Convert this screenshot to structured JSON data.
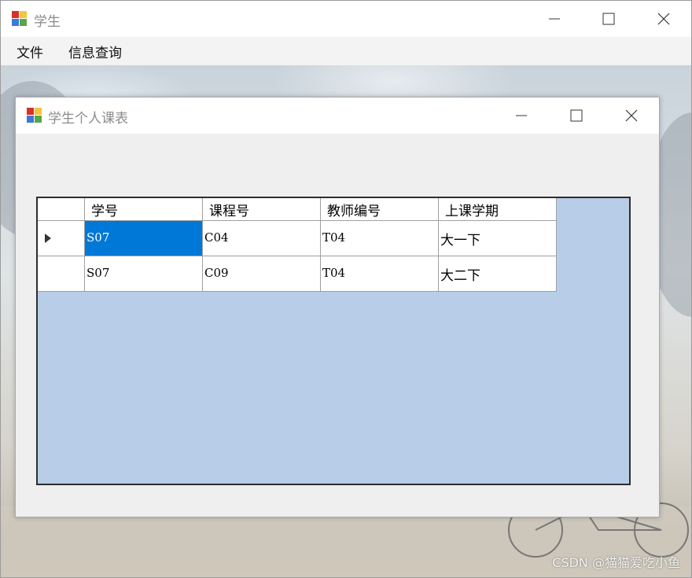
{
  "outer_window": {
    "title": "学生",
    "menu": [
      "文件",
      "信息查询"
    ]
  },
  "child_window": {
    "title": "学生个人课表"
  },
  "grid": {
    "columns": [
      "学号",
      "课程号",
      "教师编号",
      "上课学期"
    ],
    "rows": [
      [
        "S07",
        "C04",
        "T04",
        "大一下"
      ],
      [
        "S07",
        "C09",
        "T04",
        "大二下"
      ]
    ],
    "selected_row": 0,
    "selected_cell": "S07"
  },
  "colors": {
    "selection": "#0078d7",
    "grid_background": "#b7cde8",
    "window_background": "#efefef"
  },
  "icons": [
    "app-icon",
    "minimize-icon",
    "maximize-icon",
    "close-icon",
    "row-pointer-icon"
  ],
  "watermark": "CSDN @猫猫爱吃小鱼"
}
